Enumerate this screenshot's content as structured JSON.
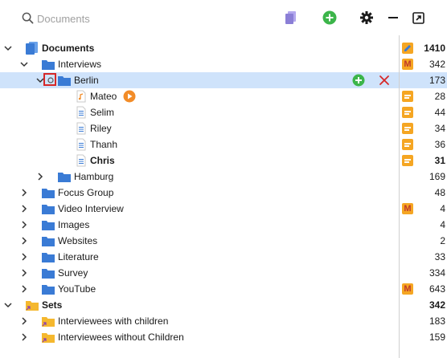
{
  "search": {
    "placeholder": "Documents"
  },
  "toolbar": {
    "icons": [
      "documents-filter-icon",
      "add-icon",
      "gear-icon",
      "minus-icon",
      "popout-icon"
    ],
    "colors": {
      "filter": "#8b7fd6",
      "add": "#3cb54a",
      "gear": "#1a1a1a"
    }
  },
  "tree": {
    "documents": {
      "label": "Documents",
      "count": "1410"
    },
    "interviews": {
      "label": "Interviews",
      "count": "342"
    },
    "berlin": {
      "label": "Berlin",
      "count": "173"
    },
    "mateo": {
      "label": "Mateo",
      "count": "28"
    },
    "selim": {
      "label": "Selim",
      "count": "44"
    },
    "riley": {
      "label": "Riley",
      "count": "34"
    },
    "thanh": {
      "label": "Thanh",
      "count": "36"
    },
    "chris": {
      "label": "Chris",
      "count": "31"
    },
    "hamburg": {
      "label": "Hamburg",
      "count": "169"
    },
    "focus_group": {
      "label": "Focus Group",
      "count": "48"
    },
    "video_interview": {
      "label": "Video Interview",
      "count": "4"
    },
    "images": {
      "label": "Images",
      "count": "4"
    },
    "websites": {
      "label": "Websites",
      "count": "2"
    },
    "literature": {
      "label": "Literature",
      "count": "33"
    },
    "survey": {
      "label": "Survey",
      "count": "334"
    },
    "youtube": {
      "label": "YouTube",
      "count": "643"
    },
    "sets": {
      "label": "Sets",
      "count": "342"
    },
    "with_children": {
      "label": "Interviewees with children",
      "count": "183"
    },
    "without_children": {
      "label": "Interviewees without Children",
      "count": "159"
    }
  },
  "colors": {
    "folder": "#3a7bd5",
    "set_folder": "#f5b82e",
    "selection": "#cfe3fb",
    "memo": "#f5a623",
    "delete": "#d62828",
    "play": "#f28c28"
  }
}
